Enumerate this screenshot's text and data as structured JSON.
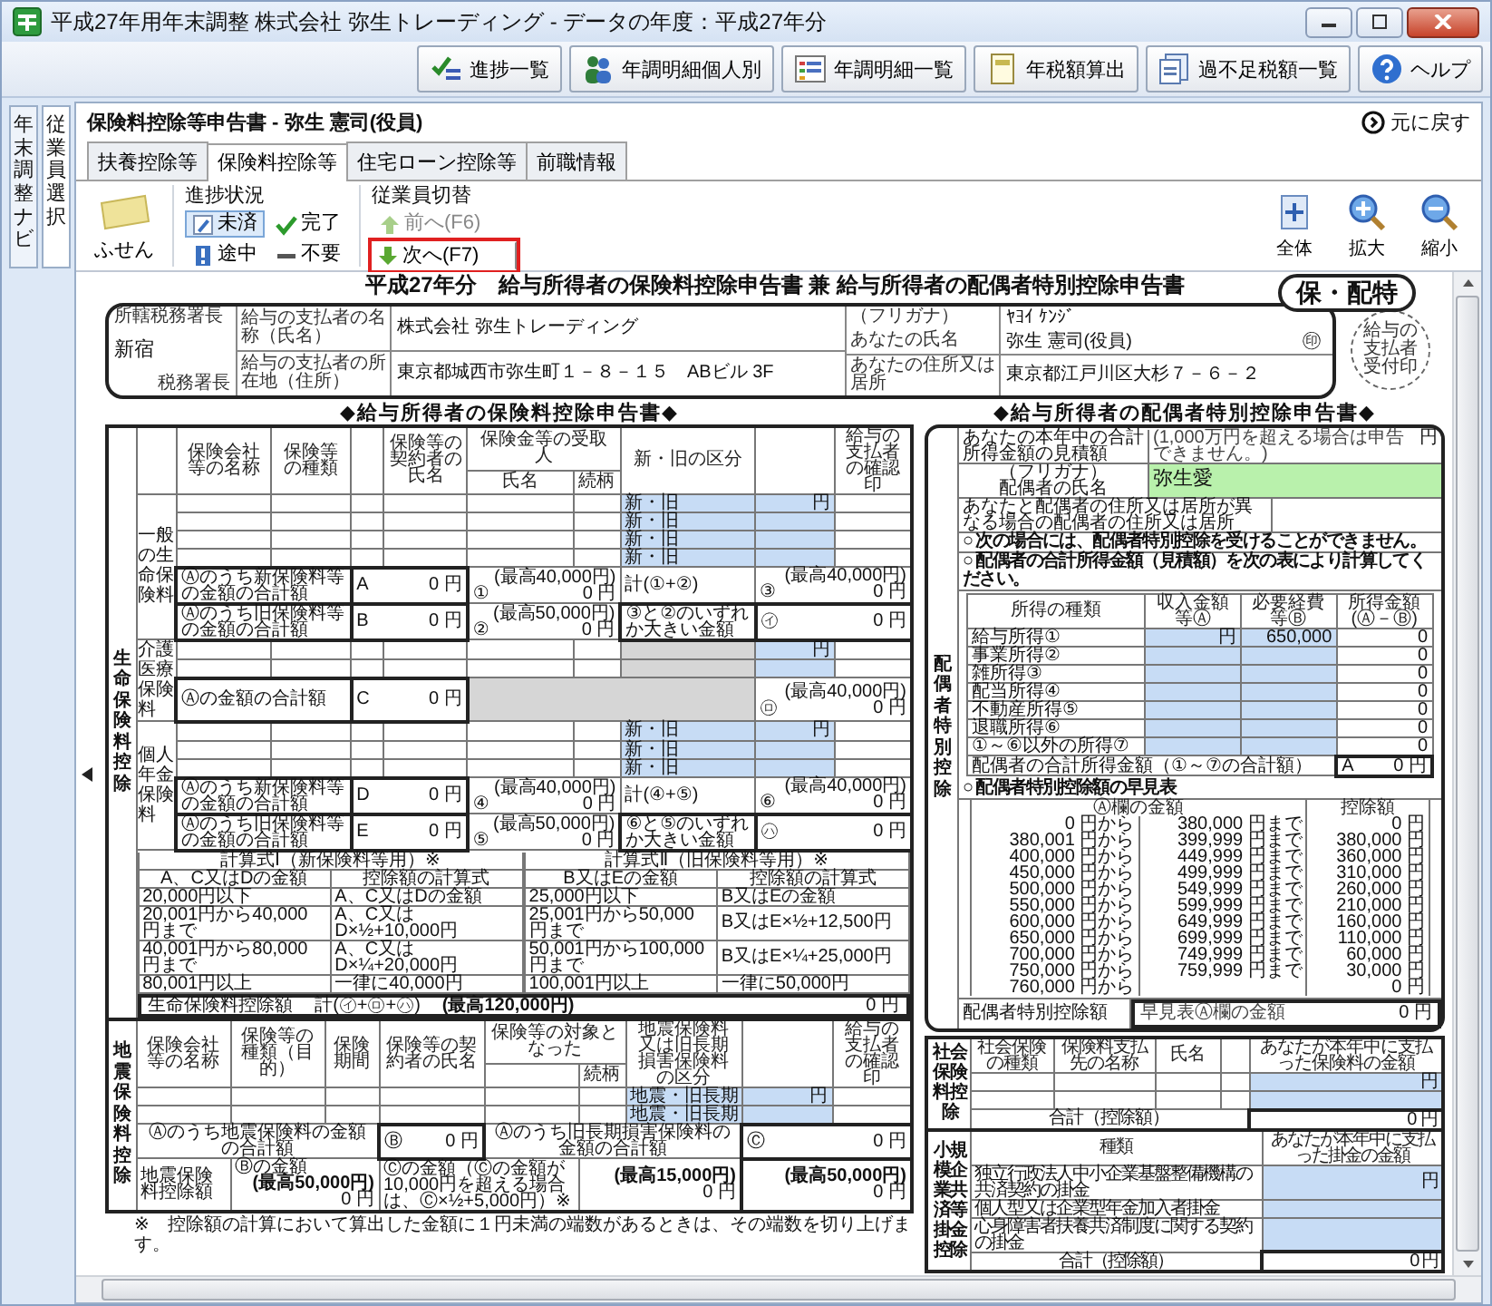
{
  "window": {
    "title": "平成27年用年末調整 株式会社 弥生トレーディング - データの年度：平成27年分"
  },
  "toolbar": [
    {
      "label": "進捗一覧",
      "kind": "check"
    },
    {
      "label": "年調明細個人別",
      "kind": "people"
    },
    {
      "label": "年調明細一覧",
      "kind": "list"
    },
    {
      "label": "年税額算出",
      "kind": "calc"
    },
    {
      "label": "過不足税額一覧",
      "kind": "doc"
    },
    {
      "label": "ヘルプ",
      "kind": "help"
    }
  ],
  "side_tabs": [
    {
      "label": "年末調整ナビ",
      "selected": false
    },
    {
      "label": "従業員選択",
      "selected": true
    }
  ],
  "page_title": "保険料控除等申告書 - 弥生 憲司(役員)",
  "back_link": "元に戻す",
  "tabs": [
    {
      "label": "扶養控除等",
      "selected": false
    },
    {
      "label": "保険料控除等",
      "selected": true
    },
    {
      "label": "住宅ローン控除等",
      "selected": false
    },
    {
      "label": "前職情報",
      "selected": false
    }
  ],
  "ribbon": {
    "sticky": "ふせん",
    "progress_title": "進捗状況",
    "progress": [
      {
        "label": "未済",
        "kind": "pencil",
        "selected": true
      },
      {
        "label": "完了",
        "kind": "check",
        "selected": false
      },
      {
        "label": "途中",
        "kind": "alert",
        "selected": false
      },
      {
        "label": "不要",
        "kind": "dash",
        "selected": false
      }
    ],
    "switch_title": "従業員切替",
    "switch": [
      {
        "label": "前へ(F6)",
        "kind": "up",
        "disabled": true,
        "highlighted": false
      },
      {
        "label": "次へ(F7)",
        "kind": "down",
        "disabled": false,
        "highlighted": true
      }
    ],
    "view": [
      {
        "label": "全体",
        "kind": "fit"
      },
      {
        "label": "拡大",
        "kind": "zoom-in"
      },
      {
        "label": "縮小",
        "kind": "zoom-out"
      }
    ]
  },
  "form": {
    "title": "平成27年分　給与所得者の保険料控除申告書 兼 給与所得者の配偶者特別控除申告書",
    "stamp": "保・配特",
    "receipt_stamp": "給与の支払者受付印",
    "header": {
      "office_label": "所轄税務署長",
      "office": "新宿",
      "office_suffix": "税務署長",
      "fields": [
        {
          "label": "給与の支払者の名称（氏名）",
          "value": "株式会社 弥生トレーディング"
        },
        {
          "label": "給与の支払者の所在地（住所）",
          "value": "東京都城西市弥生町１－８－１５　ABビル 3F"
        }
      ],
      "personal": [
        {
          "label": "（フリガナ）",
          "value": "ﾔﾖｲ ｹﾝｼﾞ"
        },
        {
          "label": "あなたの氏名",
          "value": "弥生 憲司(役員)"
        },
        {
          "label": "あなたの住所又は居所",
          "value": "東京都江戸川区大杉７－６－２"
        }
      ],
      "seal": "㊞"
    },
    "insurance": {
      "heading": "◆給与所得者の保険料控除申告書◆",
      "section_label": "生命保険料控除",
      "columns": {
        "company": "保険会社等の名称",
        "kind": "保険等の種類",
        "contractor": "保険等の契約者の氏名",
        "recipient": "保険金等の受取人",
        "name": "氏名",
        "relation": "続柄",
        "category": "新・旧の区分",
        "seal": "給与の支払者の確認印"
      },
      "groups": [
        {
          "label": "一般の生命保険料",
          "rows": [
            {
              "category": "新・旧",
              "amount": "円"
            },
            {
              "category": "新・旧"
            },
            {
              "category": "新・旧"
            },
            {
              "category": "新・旧"
            }
          ],
          "subtotals": [
            {
              "kind": "split",
              "label": "Ⓐのうち新保険料等の金額の合計額",
              "letter": "A",
              "amount": "0 円",
              "num": "①",
              "max": "(最高40,000円)",
              "calc": "0 円",
              "sum_label": "計(①+②)",
              "sum_num": "③",
              "sum_max": "(最高40,000円)",
              "sum": "0 円"
            },
            {
              "kind": "split",
              "label": "Ⓐのうち旧保険料等の金額の合計額",
              "letter": "B",
              "amount": "0 円",
              "num": "②",
              "max": "(最高50,000円)",
              "calc": "0 円",
              "sum_label": "③と②のいずれか大きい金額",
              "sum_num": "㋑",
              "sum": "0 円"
            }
          ]
        },
        {
          "label": "介護医療保険料",
          "rows": [
            {
              "amount": "円"
            },
            {}
          ],
          "subtotals": [
            {
              "kind": "single",
              "label": "Ⓐの金額の合計額",
              "letter": "C",
              "amount": "0 円",
              "sum_num": "㋺",
              "sum_max": "(最高40,000円)",
              "sum": "0 円"
            }
          ]
        },
        {
          "label": "個人年金保険料",
          "rows": [
            {
              "category": "新・旧",
              "amount": "円"
            },
            {
              "category": "新・旧"
            },
            {
              "category": "新・旧"
            }
          ],
          "subtotals": [
            {
              "kind": "split",
              "label": "Ⓐのうち新保険料等の金額の合計額",
              "letter": "D",
              "amount": "0 円",
              "num": "④",
              "max": "(最高40,000円)",
              "calc": "0 円",
              "sum_label": "計(④+⑤)",
              "sum_num": "⑥",
              "sum_max": "(最高40,000円)",
              "sum": "0 円"
            },
            {
              "kind": "split",
              "label": "Ⓐのうち旧保険料等の金額の合計額",
              "letter": "E",
              "amount": "0 円",
              "num": "⑤",
              "max": "(最高50,000円)",
              "calc": "0 円",
              "sum_label": "⑥と⑤のいずれか大きい金額",
              "sum_num": "㋩",
              "sum": "0 円"
            }
          ]
        }
      ],
      "formula": {
        "sets": [
          {
            "title": "計算式Ⅰ（新保険料等用）※",
            "col_a": "A、C又はDの金額",
            "col_b": "控除額の計算式",
            "rows": [
              [
                "20,000円以下",
                "A、C又はDの金額"
              ],
              [
                "20,001円から40,000円まで",
                "A、C又はD×½+10,000円"
              ],
              [
                "40,001円から80,000円まで",
                "A、C又はD×¼+20,000円"
              ],
              [
                "80,001円以上",
                "一律に40,000円"
              ]
            ]
          },
          {
            "title": "計算式Ⅱ（旧保険料等用）※",
            "col_a": "B又はEの金額",
            "col_b": "控除額の計算式",
            "rows": [
              [
                "25,000円以下",
                "B又はEの金額"
              ],
              [
                "25,001円から50,000円まで",
                "B又はE×½+12,500円"
              ],
              [
                "50,001円から100,000円まで",
                "B又はE×¼+25,000円"
              ],
              [
                "100,001円以上",
                "一律に50,000円"
              ]
            ]
          }
        ],
        "total_label": "生命保険料控除額",
        "total_formula": "計(㋑+㋺+㋩)",
        "total_max": "(最高120,000円)",
        "total": "0 円"
      }
    },
    "earthquake": {
      "section_label": "地震保険料控除",
      "columns": {
        "company": "保険会社等の名称",
        "kind": "保険等の種類（目的）",
        "period": "保険期間",
        "contractor": "保険等の契約者の氏名",
        "target": "保険等の対象となった",
        "relation": "続柄",
        "category": "地震保険料又は旧長期損害保険料の区分",
        "seal": "給与の支払者の確認印"
      },
      "rows": [
        {
          "category": "地震・旧長期",
          "amount": "円"
        },
        {
          "category": "地震・旧長期"
        }
      ],
      "sums": [
        {
          "label": "Ⓐのうち地震保険料の金額の合計額",
          "num": "Ⓑ",
          "amount": "0 円"
        },
        {
          "label": "Ⓐのうち旧長期損害保険料の金額の合計額",
          "num": "Ⓒ",
          "amount": "0 円"
        }
      ],
      "deduction": {
        "label": "地震保険料控除額",
        "b_label": "Ⓑの金額",
        "b_max": "(最高50,000円)",
        "b_amount": "0 円",
        "c_label": "Ⓒの金額（Ⓒの金額が10,000円を超える場合は、Ⓒ×½+5,000円）※",
        "c_max": "(最高15,000円)",
        "c_amount": "0 円",
        "total_max": "(最高50,000円)",
        "total": "0 円"
      }
    }
  },
  "spouse": {
    "heading": "◆給与所得者の配偶者特別控除申告書◆",
    "section_label": "配偶者特別控除",
    "income_label": "あなたの本年中の合計所得金額の見積額",
    "income_note": "(1,000万円を超える場合は申告できません。)",
    "income_unit": "円",
    "furigana_label": "（フリガナ）",
    "name_label": "配偶者の氏名",
    "name": "弥生愛",
    "address_label": "あなたと配偶者の住所又は居所が異なる場合の配偶者の住所又は居所",
    "notice": "○ 次の場合には、配偶者特別控除を受けることができません。",
    "calc_heading": "○ 配偶者の合計所得金額（見積額）を次の表により計算してください。",
    "income_columns": [
      "所得の種類",
      "収入金額等Ⓐ",
      "必要経費等Ⓑ",
      "所得金額(Ⓐ－Ⓑ)"
    ],
    "income_rows": [
      {
        "label": "給与所得①",
        "income": "円",
        "expense": "650,000",
        "result": "0"
      },
      {
        "label": "事業所得②",
        "result": "0"
      },
      {
        "label": "雑所得③",
        "result": "0"
      },
      {
        "label": "配当所得④",
        "result": "0"
      },
      {
        "label": "不動産所得⑤",
        "result": "0"
      },
      {
        "label": "退職所得⑥",
        "result": "0"
      },
      {
        "label": "①～⑥以外の所得⑦",
        "result": "0"
      }
    ],
    "total_label": "配偶者の合計所得金額（①～⑦の合計額）",
    "total_letter": "A",
    "total": "0 円",
    "quick_heading": "○ 配偶者特別控除額の早見表",
    "quick_columns": [
      "Ⓐ欄の金額",
      "控除額"
    ],
    "quick_rows": [
      [
        "0 円から",
        "380,000 円まで",
        "0 円"
      ],
      [
        "380,001 円から",
        "399,999 円まで",
        "380,000 円"
      ],
      [
        "400,000 円から",
        "449,999 円まで",
        "360,000 円"
      ],
      [
        "450,000 円から",
        "499,999 円まで",
        "310,000 円"
      ],
      [
        "500,000 円から",
        "549,999 円まで",
        "260,000 円"
      ],
      [
        "550,000 円から",
        "599,999 円まで",
        "210,000 円"
      ],
      [
        "600,000 円から",
        "649,999 円まで",
        "160,000 円"
      ],
      [
        "650,000 円から",
        "699,999 円まで",
        "110,000 円"
      ],
      [
        "700,000 円から",
        "749,999 円まで",
        "60,000 円"
      ],
      [
        "750,000 円から",
        "759,999 円まで",
        "30,000 円"
      ],
      [
        "760,000 円から",
        "",
        "0 円"
      ]
    ],
    "deduction_label": "配偶者特別控除額",
    "deduction_note": "早見表Ⓐ欄の金額",
    "deduction": "0 円"
  },
  "social": {
    "section_label": "社会保険料控除",
    "columns": [
      "社会保険の種類",
      "保険料支払先の名称",
      "氏名",
      "あなたが本年中に支払った保険料の金額"
    ],
    "rows": [
      {
        "amount": "円"
      },
      {}
    ],
    "total_label": "合計（控除額）",
    "total": "0 円"
  },
  "small_business": {
    "section_label": "小規模企業共済等掛金控除",
    "kind_header": "種類",
    "amount_header": "あなたが本年中に支払った掛金の金額",
    "rows": [
      {
        "label": "独立行政法人中小企業基盤整備機構の共済契約の掛金",
        "amount": "円"
      },
      {
        "label": "個人型又は企業型年金加入者掛金"
      },
      {
        "label": "心身障害者扶養共済制度に関する契約の掛金"
      }
    ],
    "total_label": "合計（控除額）",
    "total": "0 円"
  },
  "footnote": "※　控除額の計算において算出した金額に１円未満の端数があるときは、その端数を切り上げます。"
}
